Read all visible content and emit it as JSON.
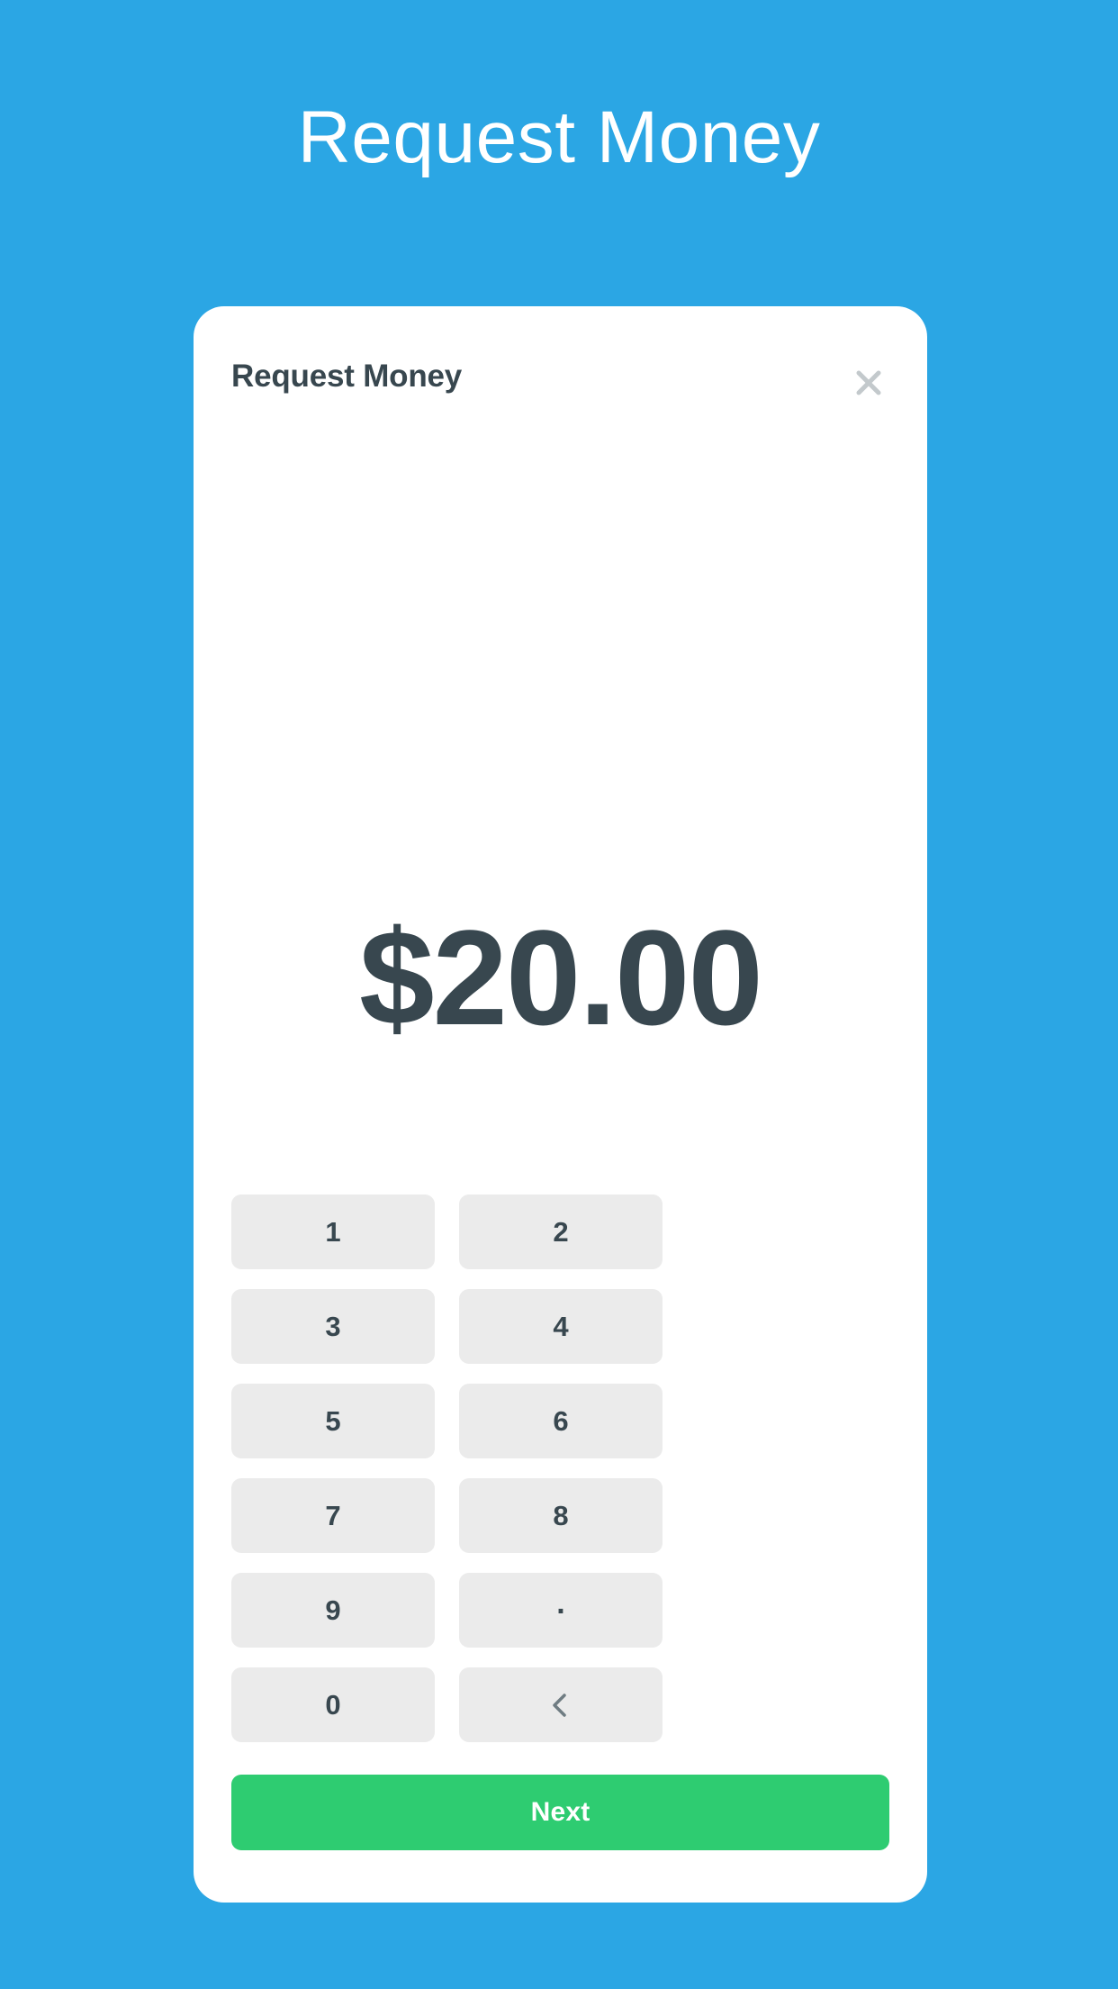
{
  "page": {
    "title": "Request Money",
    "background_color": "#2ba6e4"
  },
  "card": {
    "header": {
      "title": "Request Money",
      "close_label": "close-icon"
    },
    "amount": {
      "value": "$20.00",
      "currency_symbol": "$",
      "text_color": "#38474f"
    },
    "keypad": {
      "keys": [
        {
          "label": "1",
          "type": "digit"
        },
        {
          "label": "2",
          "type": "digit"
        },
        {
          "label": "3",
          "type": "digit"
        },
        {
          "label": "4",
          "type": "digit"
        },
        {
          "label": "5",
          "type": "digit"
        },
        {
          "label": "6",
          "type": "digit"
        },
        {
          "label": "7",
          "type": "digit"
        },
        {
          "label": "8",
          "type": "digit"
        },
        {
          "label": "9",
          "type": "digit"
        },
        {
          "label": ".",
          "type": "decimal"
        },
        {
          "label": "0",
          "type": "digit"
        },
        {
          "label": "",
          "type": "backspace"
        }
      ],
      "key_color": "#ebebeb"
    },
    "next_button": {
      "label": "Next",
      "color": "#2ecc71"
    }
  }
}
